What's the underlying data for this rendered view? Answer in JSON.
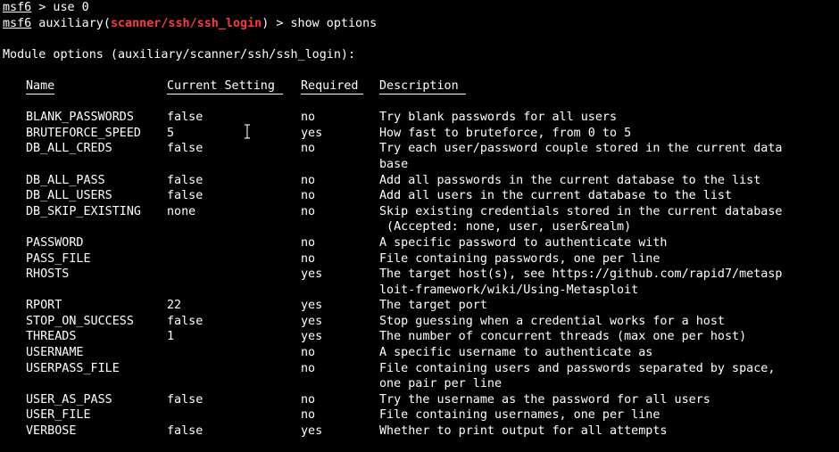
{
  "colors": {
    "background": "#000000",
    "foreground": "#ffffff",
    "module_highlight": "#ff3b3b"
  },
  "prompt": {
    "name": "msf6",
    "cmd1": " > use 0",
    "module_prefix": " auxiliary(",
    "module_name": "scanner/ssh/ssh_login",
    "module_suffix": ") > show options"
  },
  "options_heading": "Module options (auxiliary/scanner/ssh/ssh_login):",
  "columns": {
    "name": "Name",
    "setting": "Current Setting",
    "required": "Required",
    "description": "Description"
  },
  "rows": [
    {
      "name": "BLANK_PASSWORDS",
      "setting": "false",
      "required": "no",
      "desc": [
        "Try blank passwords for all users"
      ]
    },
    {
      "name": "BRUTEFORCE_SPEED",
      "setting": "5",
      "required": "yes",
      "desc": [
        "How fast to bruteforce, from 0 to 5"
      ]
    },
    {
      "name": "DB_ALL_CREDS",
      "setting": "false",
      "required": "no",
      "desc": [
        "Try each user/password couple stored in the current data",
        "base"
      ]
    },
    {
      "name": "DB_ALL_PASS",
      "setting": "false",
      "required": "no",
      "desc": [
        "Add all passwords in the current database to the list"
      ]
    },
    {
      "name": "DB_ALL_USERS",
      "setting": "false",
      "required": "no",
      "desc": [
        "Add all users in the current database to the list"
      ]
    },
    {
      "name": "DB_SKIP_EXISTING",
      "setting": "none",
      "required": "no",
      "desc": [
        "Skip existing credentials stored in the current database",
        " (Accepted: none, user, user&realm)"
      ]
    },
    {
      "name": "PASSWORD",
      "setting": "",
      "required": "no",
      "desc": [
        "A specific password to authenticate with"
      ]
    },
    {
      "name": "PASS_FILE",
      "setting": "",
      "required": "no",
      "desc": [
        "File containing passwords, one per line"
      ]
    },
    {
      "name": "RHOSTS",
      "setting": "",
      "required": "yes",
      "desc": [
        "The target host(s), see https://github.com/rapid7/metasp",
        "loit-framework/wiki/Using-Metasploit"
      ]
    },
    {
      "name": "RPORT",
      "setting": "22",
      "required": "yes",
      "desc": [
        "The target port"
      ]
    },
    {
      "name": "STOP_ON_SUCCESS",
      "setting": "false",
      "required": "yes",
      "desc": [
        "Stop guessing when a credential works for a host"
      ]
    },
    {
      "name": "THREADS",
      "setting": "1",
      "required": "yes",
      "desc": [
        "The number of concurrent threads (max one per host)"
      ]
    },
    {
      "name": "USERNAME",
      "setting": "",
      "required": "no",
      "desc": [
        "A specific username to authenticate as"
      ]
    },
    {
      "name": "USERPASS_FILE",
      "setting": "",
      "required": "no",
      "desc": [
        "File containing users and passwords separated by space,",
        "one pair per line"
      ]
    },
    {
      "name": "USER_AS_PASS",
      "setting": "false",
      "required": "no",
      "desc": [
        "Try the username as the password for all users"
      ]
    },
    {
      "name": "USER_FILE",
      "setting": "",
      "required": "no",
      "desc": [
        "File containing usernames, one per line"
      ]
    },
    {
      "name": "VERBOSE",
      "setting": "false",
      "required": "yes",
      "desc": [
        "Whether to print output for all attempts"
      ]
    }
  ],
  "icons": {
    "mouse_cursor": "ibeam-cursor-icon"
  }
}
